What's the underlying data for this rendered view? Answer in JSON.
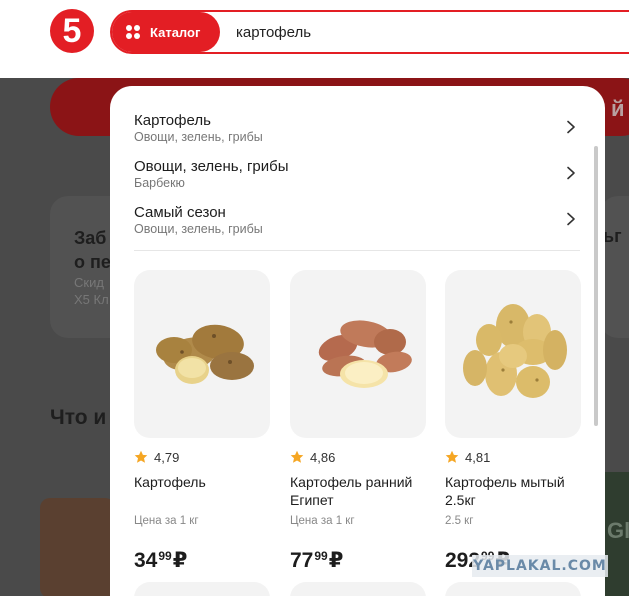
{
  "header": {
    "logo_text": "5",
    "catalog_label": "Каталог",
    "search_value": "картофель"
  },
  "background": {
    "card_left_text": "Заб\nо пе",
    "card_left_sub": "Скид\nX5 Кл",
    "card_right_text": "ьг",
    "section_title": "Что и",
    "banner_right_text": "й",
    "promo_text": "Gl"
  },
  "suggestions": [
    {
      "title": "Картофель",
      "subtitle": "Овощи, зелень, грибы"
    },
    {
      "title": "Овощи, зелень, грибы",
      "subtitle": "Барбекю"
    },
    {
      "title": "Самый сезон",
      "subtitle": "Овощи, зелень, грибы"
    }
  ],
  "products": [
    {
      "rating": "4,79",
      "name": "Картофель",
      "unit": "Цена за 1 кг",
      "price_main": "34",
      "price_cents": "99",
      "currency": "₽"
    },
    {
      "rating": "4,86",
      "name": "Картофель ранний Египет",
      "unit": "Цена за 1 кг",
      "price_main": "77",
      "price_cents": "99",
      "currency": "₽"
    },
    {
      "rating": "4,81",
      "name": "Картофель мытый 2.5кг",
      "unit": "2.5 кг",
      "price_main": "292",
      "price_cents": "99",
      "currency": "₽"
    }
  ],
  "watermark": "YAPLAKAL.COM",
  "colors": {
    "brand_red": "#e31e24",
    "star": "#f5a623"
  }
}
